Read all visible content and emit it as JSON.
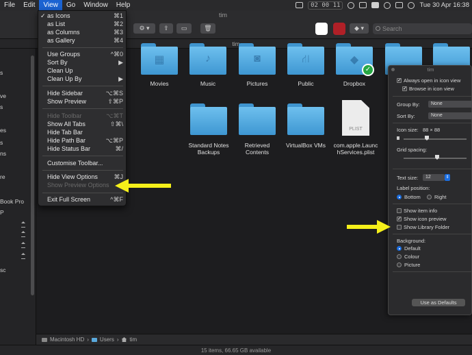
{
  "menubar": {
    "items": [
      "File",
      "Edit",
      "View",
      "Go",
      "Window",
      "Help"
    ],
    "clock_readout": "02 00 11",
    "battery": "100",
    "datetime": "Tue 30 Apr  16:38"
  },
  "window": {
    "title": "tim",
    "path_tab": "tim"
  },
  "search": {
    "placeholder": "Search"
  },
  "view_menu": {
    "items": [
      {
        "label": "as Icons",
        "shortcut": "⌘1",
        "checked": true
      },
      {
        "label": "as List",
        "shortcut": "⌘2"
      },
      {
        "label": "as Columns",
        "shortcut": "⌘3"
      },
      {
        "label": "as Gallery",
        "shortcut": "⌘4"
      },
      {
        "label": "Use Groups",
        "shortcut": "^⌘0"
      },
      {
        "label": "Sort By",
        "shortcut": "▶"
      },
      {
        "label": "Clean Up",
        "shortcut": ""
      },
      {
        "label": "Clean Up By",
        "shortcut": "▶"
      },
      {
        "label": "Hide Sidebar",
        "shortcut": "⌥⌘S"
      },
      {
        "label": "Show Preview",
        "shortcut": "⇧⌘P"
      },
      {
        "label": "Hide Toolbar",
        "shortcut": "⌥⌘T",
        "disabled": true
      },
      {
        "label": "Show All Tabs",
        "shortcut": "⇧⌘\\"
      },
      {
        "label": "Hide Tab Bar",
        "shortcut": ""
      },
      {
        "label": "Hide Path Bar",
        "shortcut": "⌥⌘P"
      },
      {
        "label": "Hide Status Bar",
        "shortcut": "⌘/"
      },
      {
        "label": "Customise Toolbar...",
        "shortcut": ""
      },
      {
        "label": "Hide View Options",
        "shortcut": "⌘J"
      },
      {
        "label": "Show Preview Options",
        "shortcut": "",
        "disabled": true
      },
      {
        "label": "Exit Full Screen",
        "shortcut": "^⌘F"
      }
    ]
  },
  "sidebar": {
    "fragments": [
      "s",
      "ve",
      "s",
      "es",
      "s",
      "ns",
      "re",
      "Book Pro",
      "P",
      "sc"
    ]
  },
  "files": {
    "top_row": [
      "Movies",
      "Music",
      "Pictures",
      "Public",
      "Dropbox"
    ],
    "second_row": [
      {
        "line1": "Standard Notes",
        "line2": "Backups"
      },
      {
        "line1": "Retrieved",
        "line2": "Contents"
      },
      {
        "line1": "VirtualBox VMs",
        "line2": ""
      },
      {
        "line1": "com.apple.Launc",
        "line2": "hServices.plist"
      }
    ],
    "plist_badge": "PLIST"
  },
  "pathbar": {
    "parts": [
      "Macintosh HD",
      "Users",
      "tim"
    ]
  },
  "statusbar": {
    "text": "15 items, 66.65 GB available"
  },
  "view_options": {
    "title": "tim",
    "always_open": "Always open in icon view",
    "browse_in": "Browse in icon view",
    "group_by_label": "Group By:",
    "group_by_value": "None",
    "sort_by_label": "Sort By:",
    "sort_by_value": "None",
    "icon_size_label": "Icon size:",
    "icon_size_value": "88 × 88",
    "grid_spacing_label": "Grid spacing:",
    "text_size_label": "Text size:",
    "text_size_value": "12",
    "label_position": "Label position:",
    "bottom": "Bottom",
    "right": "Right",
    "show_item_info": "Show item info",
    "show_icon_preview": "Show icon preview",
    "show_library_folder": "Show Library Folder",
    "background_label": "Background:",
    "bg_default": "Default",
    "bg_colour": "Colour",
    "bg_picture": "Picture",
    "use_as_defaults": "Use as Defaults"
  },
  "colors": {
    "accent": "#1b63d2",
    "folder": "#5bb0e4",
    "arrow": "#f5f01a"
  }
}
